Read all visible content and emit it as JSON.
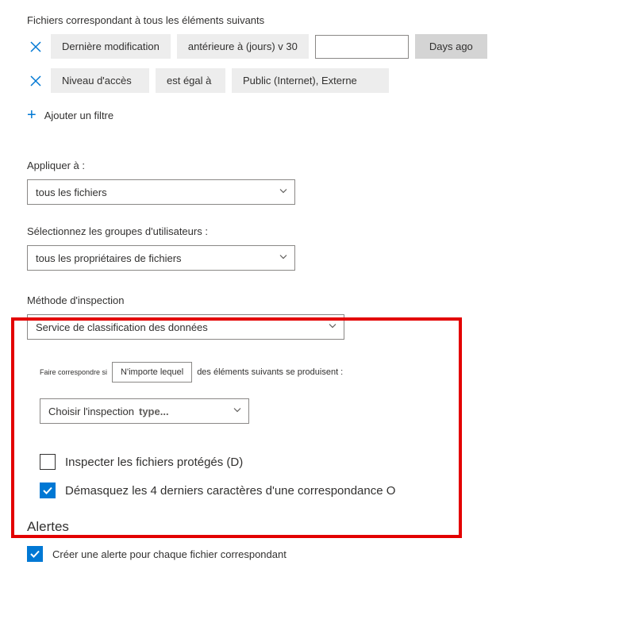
{
  "filters": {
    "heading": "Fichiers correspondant à tous les éléments suivants",
    "row1": {
      "field": "Dernière modification",
      "op": "antérieure à (jours) v 30",
      "unit": "Days ago"
    },
    "row2": {
      "field": "Niveau d'accès",
      "op": "est égal à",
      "value": "Public (Internet), Externe"
    },
    "add": "Ajouter un filtre"
  },
  "apply": {
    "label": "Appliquer à :",
    "value": "tous les fichiers"
  },
  "groups": {
    "label": "Sélectionnez les groupes d'utilisateurs :",
    "value": "tous les propriétaires de fichiers"
  },
  "inspection": {
    "label": "Méthode d'inspection",
    "value": "Service de classification des données",
    "match_prefix": "Faire correspondre si",
    "match_select": "N'importe lequel",
    "match_suffix": "des éléments suivants se produisent :",
    "choose_prefix": "Choisir l'inspection",
    "choose_value": "type...",
    "cb1": "Inspecter les fichiers protégés (D)",
    "cb2": "Démasquez les 4 derniers caractères d'une correspondance O"
  },
  "alerts": {
    "heading": "Alertes",
    "cb": "Créer une alerte pour chaque fichier correspondant"
  }
}
